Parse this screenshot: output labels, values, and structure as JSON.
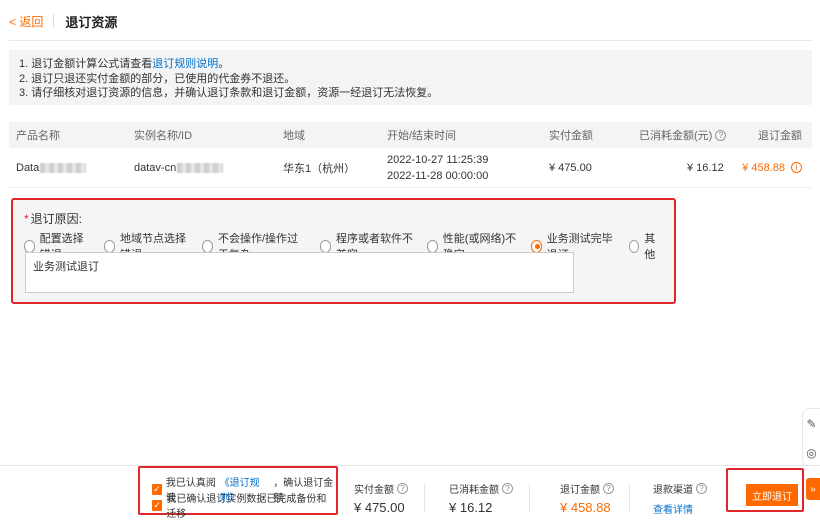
{
  "header": {
    "back_label": "< 返回",
    "title": "退订资源"
  },
  "notice": {
    "line1_prefix": "1. 退订金额计算公式请查看",
    "line1_link": "退订规则说明",
    "line1_suffix": "。",
    "line2": "2. 退订只退还实付金额的部分，已使用的代金券不退还。",
    "line3": "3. 请仔细核对退订资源的信息，并确认退订条款和退订金额，资源一经退订无法恢复。"
  },
  "table": {
    "headers": {
      "product": "产品名称",
      "instance": "实例名称/ID",
      "region": "地域",
      "time": "开始/结束时间",
      "paid": "实付金额",
      "consumed": "已消耗金额(元)",
      "refund": "退订金额"
    },
    "row": {
      "product": "Data",
      "instance": "datav-cn",
      "region": "华东1（杭州）",
      "start": "2022-10-27 11:25:39",
      "end": "2022-11-28 00:00:00",
      "paid": "¥ 475.00",
      "consumed": "¥ 16.12",
      "refund": "¥ 458.88"
    }
  },
  "reason": {
    "title": "退订原因:",
    "options": [
      "配置选择错误",
      "地域节点选择错误",
      "不会操作/操作过于复杂",
      "程序或者软件不兼容",
      "性能(或网络)不稳定",
      "业务测试完毕退订",
      "其他"
    ],
    "selected_index": 5,
    "text": "业务测试退订"
  },
  "footer": {
    "agree1_prefix": "我已认真阅读",
    "agree1_link": "《退订规则》",
    "agree1_suffix": "，确认退订金额",
    "agree2": "我已确认退订实例数据已完成备份和迁移",
    "paid_label": "实付金额",
    "paid_value": "¥ 475.00",
    "consumed_label": "已消耗金额",
    "consumed_value": "¥ 16.12",
    "refund_label": "退订金额",
    "refund_value": "¥ 458.88",
    "channel_label": "退款渠道",
    "channel_link": "查看详情",
    "submit_label": "立即退订"
  },
  "colors": {
    "accent": "#ff6a00",
    "link": "#0070cc",
    "highlight": "#e0262b"
  },
  "icons": [
    "help-icon",
    "info-icon",
    "edit-icon",
    "chat-icon",
    "expand-icon",
    "check-icon"
  ]
}
